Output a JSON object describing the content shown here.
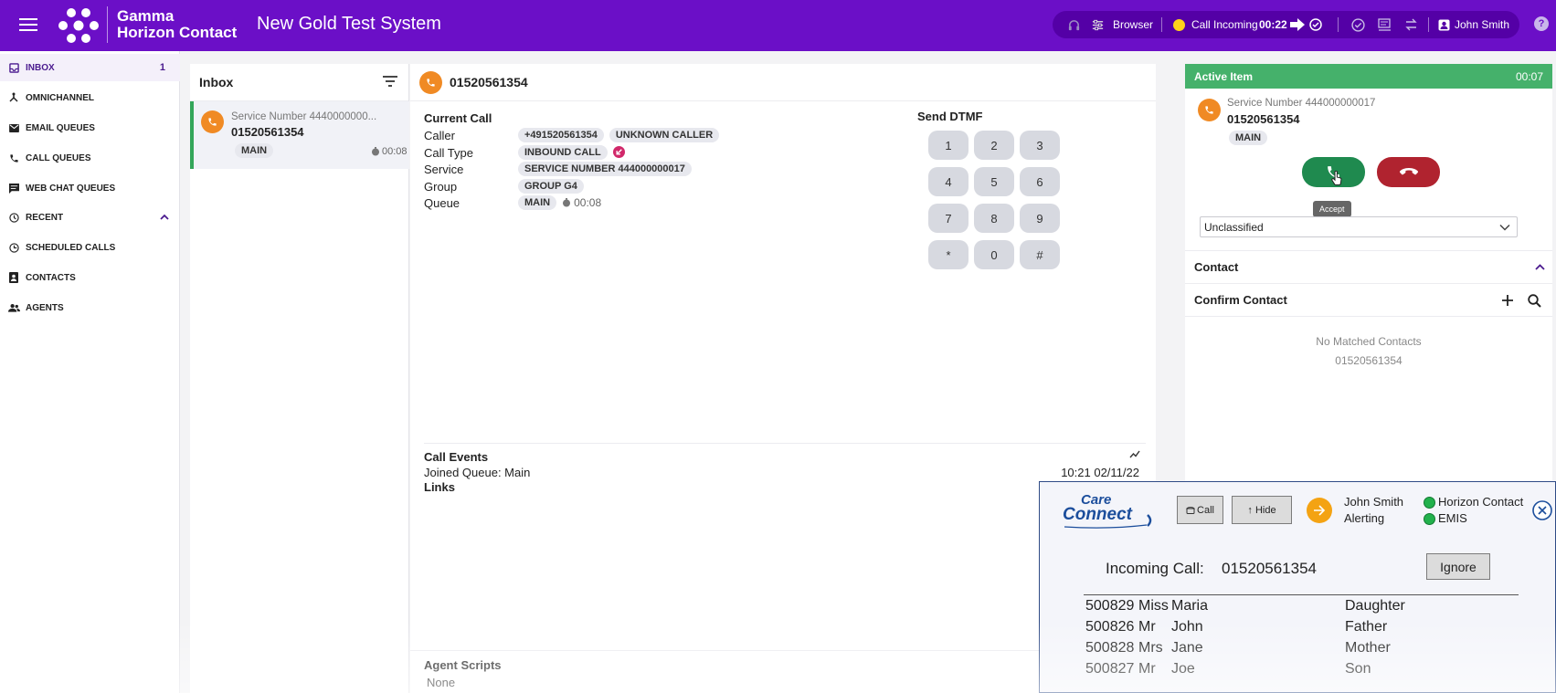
{
  "header": {
    "brand_line1": "Gamma",
    "brand_line2": "Horizon Contact",
    "system_name": "New Gold Test System",
    "browser_label": "Browser",
    "call_status": "Call Incoming",
    "call_timer": "00:22",
    "user_name": "John Smith",
    "help_label": "?"
  },
  "sidebar": {
    "items": [
      {
        "label": "INBOX",
        "count": "1",
        "icon": "inbox-icon"
      },
      {
        "label": "OMNICHANNEL",
        "icon": "omnichannel-icon"
      },
      {
        "label": "EMAIL QUEUES",
        "icon": "email-icon"
      },
      {
        "label": "CALL QUEUES",
        "icon": "phone-icon"
      },
      {
        "label": "WEB CHAT QUEUES",
        "icon": "chat-icon"
      },
      {
        "label": "RECENT",
        "icon": "recent-icon"
      },
      {
        "label": "SCHEDULED CALLS",
        "icon": "clock-icon"
      },
      {
        "label": "CONTACTS",
        "icon": "contacts-icon"
      },
      {
        "label": "AGENTS",
        "icon": "agents-icon"
      }
    ]
  },
  "inbox": {
    "title": "Inbox",
    "item": {
      "service": "Service Number 4440000000...",
      "number": "01520561354",
      "queue": "MAIN",
      "time": "00:08"
    }
  },
  "main": {
    "header_number": "01520561354",
    "current_call": {
      "title": "Current Call",
      "caller_label": "Caller",
      "caller_number": "+491520561354",
      "caller_name": "UNKNOWN CALLER",
      "call_type_label": "Call Type",
      "call_type": "INBOUND CALL",
      "service_label": "Service",
      "service": "SERVICE NUMBER 444000000017",
      "group_label": "Group",
      "group": "GROUP G4",
      "queue_label": "Queue",
      "queue": "MAIN",
      "queue_time": "00:08"
    },
    "dtmf": {
      "title": "Send DTMF",
      "keys": [
        "1",
        "2",
        "3",
        "4",
        "5",
        "6",
        "7",
        "8",
        "9",
        "*",
        "0",
        "#"
      ]
    },
    "events": {
      "title": "Call Events",
      "entry": "Joined Queue: Main",
      "entry_time": "10:21 02/11/22",
      "links_title": "Links"
    },
    "scripts": {
      "title": "Agent Scripts",
      "value": "None"
    }
  },
  "right": {
    "active_title": "Active Item",
    "active_timer": "00:07",
    "service": "Service Number 444000000017",
    "number": "01520561354",
    "queue": "MAIN",
    "accept_tooltip": "Accept",
    "classification": "Unclassified",
    "contact_title": "Contact",
    "confirm_title": "Confirm Contact",
    "no_match": "No Matched Contacts",
    "no_match_number": "01520561354"
  },
  "careconnect": {
    "logo_line1": "Care",
    "logo_line2": "Connect",
    "call_button": "Call",
    "hide_button": "↑ Hide",
    "agent_name": "John Smith",
    "agent_status": "Alerting",
    "system1": "Horizon Contact",
    "system2": "EMIS",
    "incoming_label": "Incoming Call:",
    "incoming_number": "01520561354",
    "ignore_button": "Ignore",
    "rows": [
      {
        "id": "500829",
        "title": "Miss",
        "name": "Maria",
        "relation": "Daughter"
      },
      {
        "id": "500826",
        "title": "Mr",
        "name": "John",
        "relation": "Father"
      },
      {
        "id": "500828",
        "title": "Mrs",
        "name": "Jane",
        "relation": "Mother"
      },
      {
        "id": "500827",
        "title": "Mr",
        "name": "Joe",
        "relation": "Son"
      }
    ]
  },
  "colors": {
    "header_bg": "#6b0fc7",
    "active_green": "#45b16b",
    "accept_green": "#1f8a4f",
    "reject_red": "#b0232f",
    "avatar_orange": "#f08a24"
  }
}
